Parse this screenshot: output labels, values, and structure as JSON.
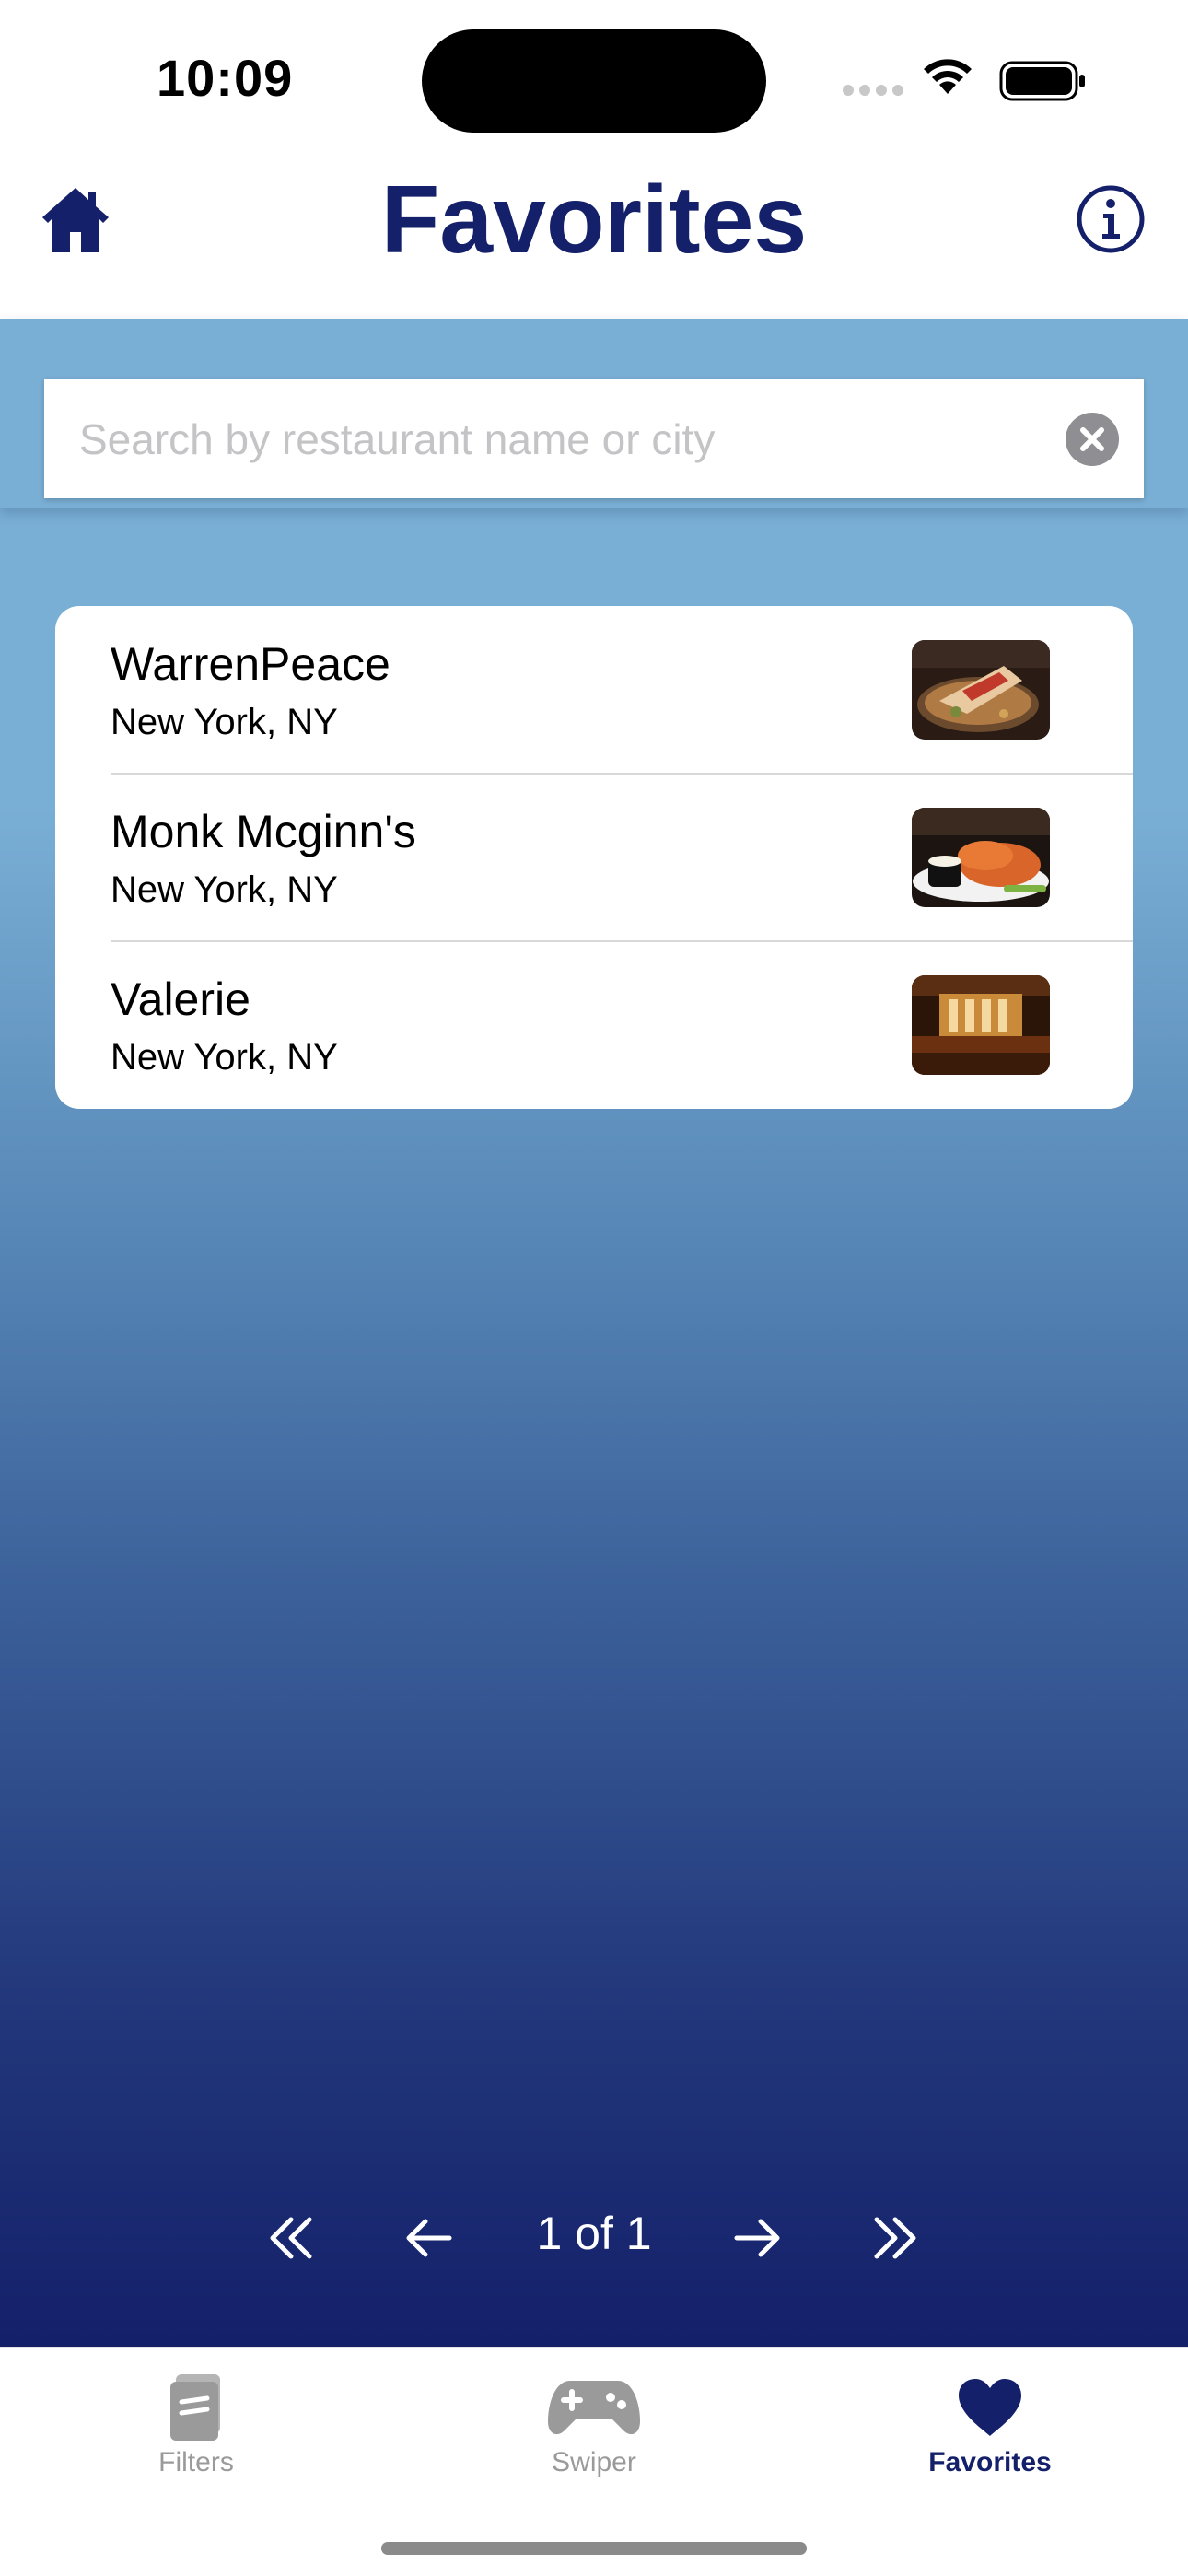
{
  "status_bar": {
    "time": "10:09"
  },
  "header": {
    "title": "Favorites",
    "home_icon": "home-icon",
    "info_icon": "info-icon"
  },
  "search": {
    "placeholder": "Search by restaurant name or city",
    "value": ""
  },
  "favorites": [
    {
      "name": "WarrenPeace",
      "city": "New York, NY",
      "thumb": "food-plate"
    },
    {
      "name": "Monk Mcginn's",
      "city": "New York, NY",
      "thumb": "chicken-wings"
    },
    {
      "name": "Valerie",
      "city": "New York, NY",
      "thumb": "restaurant-interior"
    }
  ],
  "pagination": {
    "label": "1 of 1"
  },
  "tabs": [
    {
      "label": "Filters",
      "icon": "filters-icon",
      "active": false
    },
    {
      "label": "Swiper",
      "icon": "gamepad-icon",
      "active": false
    },
    {
      "label": "Favorites",
      "icon": "heart-icon",
      "active": true
    }
  ],
  "colors": {
    "navy": "#14206a",
    "sky": "#7aafd5"
  }
}
